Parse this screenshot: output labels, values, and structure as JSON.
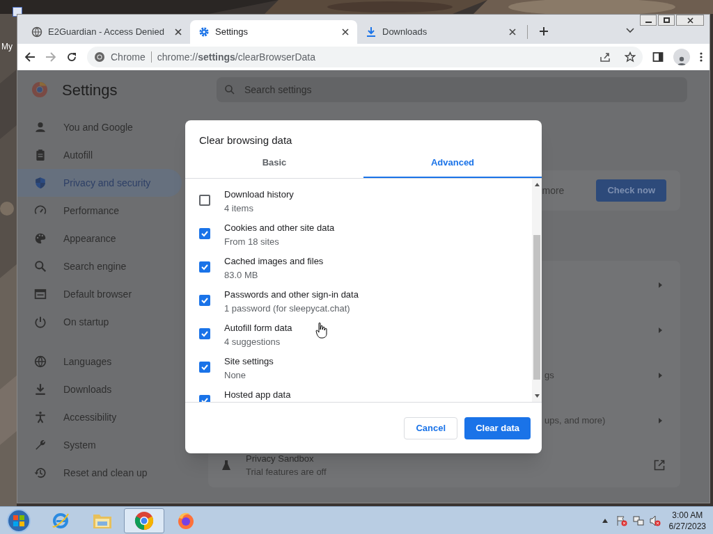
{
  "desktop": {
    "icon_label": "My"
  },
  "tabs": [
    {
      "title": "E2Guardian - Access Denied",
      "selected": false
    },
    {
      "title": "Settings",
      "selected": true
    },
    {
      "title": "Downloads",
      "selected": false
    }
  ],
  "toolbar": {
    "site_label": "Chrome",
    "url": "chrome://**settings**/clearBrowserData"
  },
  "settings": {
    "title": "Settings",
    "search_placeholder": "Search settings",
    "sidebar_groups": [
      [
        {
          "label": "You and Google",
          "selected": false
        },
        {
          "label": "Autofill",
          "selected": false
        },
        {
          "label": "Privacy and security",
          "selected": true
        },
        {
          "label": "Performance",
          "selected": false
        },
        {
          "label": "Appearance",
          "selected": false
        },
        {
          "label": "Search engine",
          "selected": false
        },
        {
          "label": "Default browser",
          "selected": false
        },
        {
          "label": "On startup",
          "selected": false
        }
      ],
      [
        {
          "label": "Languages",
          "selected": false
        },
        {
          "label": "Downloads",
          "selected": false
        },
        {
          "label": "Accessibility",
          "selected": false
        },
        {
          "label": "System",
          "selected": false
        },
        {
          "label": "Reset and clean up",
          "selected": false
        }
      ]
    ],
    "safety_card": {
      "text_fragment": "more",
      "button": "Check now"
    },
    "privacy_row_fragments": [
      "gs",
      "ups, and more)"
    ],
    "sandbox_row": {
      "title": "Privacy Sandbox",
      "subtitle": "Trial features are off"
    }
  },
  "dialog": {
    "title": "Clear browsing data",
    "tabs": [
      {
        "label": "Basic",
        "selected": false
      },
      {
        "label": "Advanced",
        "selected": true
      }
    ],
    "items": [
      {
        "label": "Download history",
        "detail": "4 items",
        "checked": false
      },
      {
        "label": "Cookies and other site data",
        "detail": "From 18 sites",
        "checked": true
      },
      {
        "label": "Cached images and files",
        "detail": "83.0 MB",
        "checked": true
      },
      {
        "label": "Passwords and other sign-in data",
        "detail": "1 password (for sleepycat.chat)",
        "checked": true
      },
      {
        "label": "Autofill form data",
        "detail": "4 suggestions",
        "checked": true
      },
      {
        "label": "Site settings",
        "detail": "None",
        "checked": true
      },
      {
        "label": "Hosted app data",
        "checked": true
      }
    ],
    "buttons": [
      {
        "label": "Cancel",
        "kind": "secondary"
      },
      {
        "label": "Clear data",
        "kind": "primary"
      }
    ]
  },
  "taskbar": {
    "apps": [
      {
        "active": false
      },
      {
        "active": false
      },
      {
        "active": true
      },
      {
        "active": false
      }
    ],
    "time": "3:00 AM",
    "date": "6/27/2023"
  }
}
